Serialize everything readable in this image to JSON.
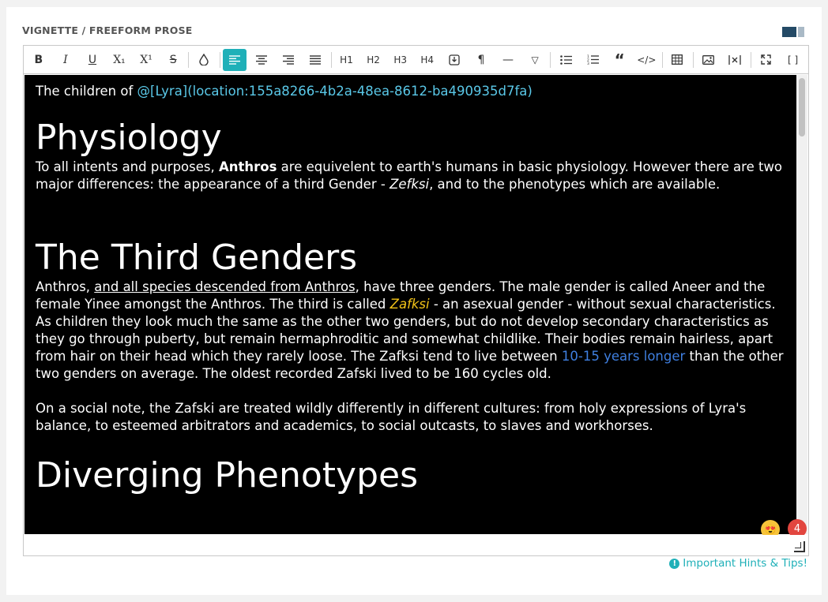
{
  "section": {
    "title": "VIGNETTE / FREEFORM PROSE"
  },
  "toolbar": {
    "bold": "B",
    "italic": "I",
    "underline": "U",
    "subscript": "X₁",
    "superscript": "X¹",
    "strike": "S",
    "color": "💧",
    "h1": "H1",
    "h2": "H2",
    "h3": "H3",
    "h4": "H4",
    "paragraph": "¶",
    "rule": "—",
    "more": "▽",
    "quote": "“",
    "code": "</>",
    "fullscreen": "⤢",
    "brackets": "[ ]"
  },
  "content": {
    "intro_prefix": "The children of ",
    "intro_mention": "@[Lyra](location:155a8266-4b2a-48ea-8612-ba490935d7fa)",
    "h_physiology": "Physiology",
    "p1_a": "To all intents and purposes, ",
    "p1_bold": "Anthros",
    "p1_b": " are equivelent to earth's humans in basic physiology. However there are two major differences:  the appearance of a third Gender - ",
    "p1_italic": "Zefksi",
    "p1_c": ", and to the phenotypes which are available.",
    "h_third": "The Third Genders",
    "p2_a": "Anthros, ",
    "p2_u": "and all species descended from Anthros",
    "p2_b": ", have three genders. The male gender is called Aneer and the female Yinee amongst the Anthros. The third is called ",
    "p2_zaf": "Zafksi",
    "p2_c": " - an asexual gender  - without sexual characteristics. As children they look much the same as the other two genders, but do not develop secondary characteristics as they go through puberty, but remain hermaphroditic and somewhat childlike. Their bodies remain hairless, apart from hair on their head which they rarely loose. The Zafksi tend to live between ",
    "p2_blue": "10-15 years longer",
    "p2_d": " than the other two genders on average. The oldest recorded Zafski lived to be 160 cycles old.",
    "p3": "On a social note, the Zafski are treated wildly differently in different cultures: from holy expressions of Lyra's balance, to esteemed arbitrators and academics, to social outcasts, to slaves and workhorses.",
    "h_diverging": "Diverging Phenotypes"
  },
  "reactions": {
    "emoji": "😍",
    "count": "4"
  },
  "hints": {
    "label": "Important Hints & Tips!"
  },
  "colors": {
    "accent": "#1fb0b8",
    "mention": "#5ac8e8",
    "zafksi": "#f2c318",
    "link_blue": "#3f7fe0",
    "badge": "#e2463f"
  }
}
